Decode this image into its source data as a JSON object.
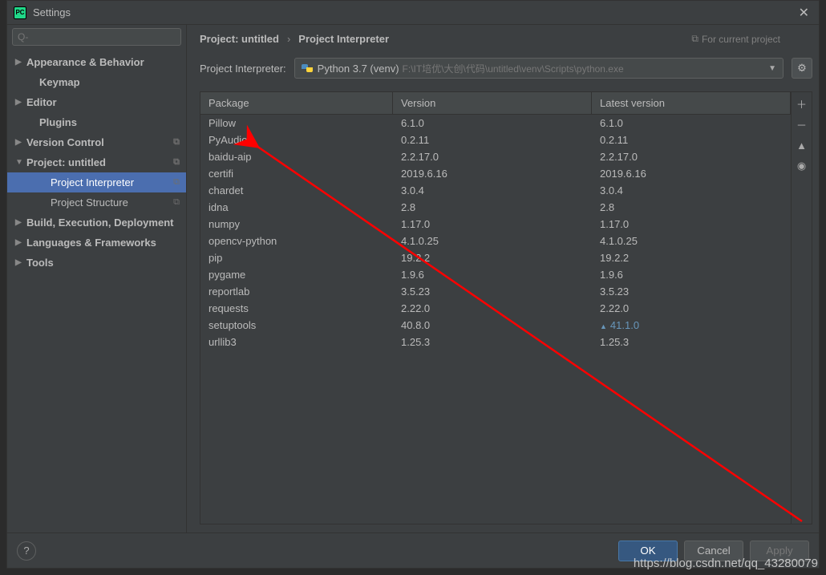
{
  "title": "Settings",
  "search_placeholder": "Q-",
  "sidebar": [
    {
      "label": "Appearance & Behavior",
      "arrow": "▶",
      "bold": true
    },
    {
      "label": "Keymap",
      "arrow": "",
      "bold": true,
      "child": true
    },
    {
      "label": "Editor",
      "arrow": "▶",
      "bold": true
    },
    {
      "label": "Plugins",
      "arrow": "",
      "bold": true,
      "child": true
    },
    {
      "label": "Version Control",
      "arrow": "▶",
      "bold": true,
      "copy": true
    },
    {
      "label": "Project: untitled",
      "arrow": "▼",
      "bold": true,
      "copy": true
    },
    {
      "label": "Project Interpreter",
      "arrow": "",
      "bold": false,
      "child2": true,
      "selected": true,
      "copy": true
    },
    {
      "label": "Project Structure",
      "arrow": "",
      "bold": false,
      "child2": true,
      "copy": true
    },
    {
      "label": "Build, Execution, Deployment",
      "arrow": "▶",
      "bold": true
    },
    {
      "label": "Languages & Frameworks",
      "arrow": "▶",
      "bold": true
    },
    {
      "label": "Tools",
      "arrow": "▶",
      "bold": true
    }
  ],
  "breadcrumb": {
    "bc1": "Project: untitled",
    "sep": "›",
    "bc2": "Project Interpreter"
  },
  "hint": "For current project",
  "interpreter": {
    "label": "Project Interpreter:",
    "name": "Python 3.7 (venv)",
    "path": "F:\\IT培优\\大创\\代码\\untitled\\venv\\Scripts\\python.exe"
  },
  "columns": {
    "c1": "Package",
    "c2": "Version",
    "c3": "Latest version"
  },
  "packages": [
    {
      "name": "Pillow",
      "version": "6.1.0",
      "latest": "6.1.0"
    },
    {
      "name": "PyAudio",
      "version": "0.2.11",
      "latest": "0.2.11"
    },
    {
      "name": "baidu-aip",
      "version": "2.2.17.0",
      "latest": "2.2.17.0"
    },
    {
      "name": "certifi",
      "version": "2019.6.16",
      "latest": "2019.6.16"
    },
    {
      "name": "chardet",
      "version": "3.0.4",
      "latest": "3.0.4"
    },
    {
      "name": "idna",
      "version": "2.8",
      "latest": "2.8"
    },
    {
      "name": "numpy",
      "version": "1.17.0",
      "latest": "1.17.0"
    },
    {
      "name": "opencv-python",
      "version": "4.1.0.25",
      "latest": "4.1.0.25"
    },
    {
      "name": "pip",
      "version": "19.2.2",
      "latest": "19.2.2"
    },
    {
      "name": "pygame",
      "version": "1.9.6",
      "latest": "1.9.6"
    },
    {
      "name": "reportlab",
      "version": "3.5.23",
      "latest": "3.5.23"
    },
    {
      "name": "requests",
      "version": "2.22.0",
      "latest": "2.22.0"
    },
    {
      "name": "setuptools",
      "version": "40.8.0",
      "latest": "41.1.0",
      "upgrade": true
    },
    {
      "name": "urllib3",
      "version": "1.25.3",
      "latest": "1.25.3"
    }
  ],
  "buttons": {
    "ok": "OK",
    "cancel": "Cancel",
    "apply": "Apply"
  },
  "watermark": "https://blog.csdn.net/qq_43280079"
}
